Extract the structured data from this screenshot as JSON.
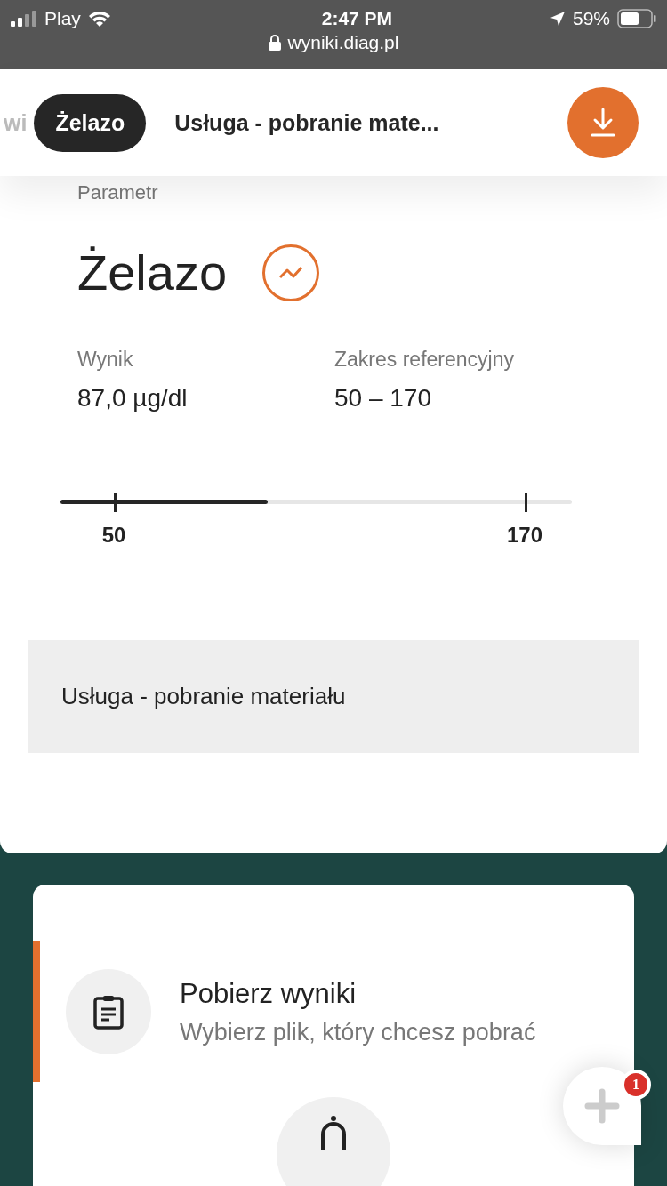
{
  "status_bar": {
    "carrier": "Play",
    "time": "2:47 PM",
    "battery": "59%",
    "url": "wyniki.diag.pl"
  },
  "tabs": [
    {
      "label": "wi",
      "selected": false
    },
    {
      "label": "Żelazo",
      "selected": true
    },
    {
      "label": "Usługa - pobranie mate...",
      "selected": false
    }
  ],
  "parameter": {
    "caption": "Parametr",
    "name": "Żelazo",
    "fields": [
      {
        "label": "Wynik",
        "value": "87,0 µg/dl"
      },
      {
        "label": "Zakres referencyjny",
        "value": "50 – 170"
      }
    ],
    "range": {
      "level": 0.405,
      "low": "50",
      "high": "170"
    }
  },
  "service": "Usługa - pobranie materiału",
  "download_card": {
    "title": "Pobierz wyniki",
    "subtitle": "Wybierz plik, który chcesz pobrać"
  },
  "chat": {
    "badge": "1"
  }
}
